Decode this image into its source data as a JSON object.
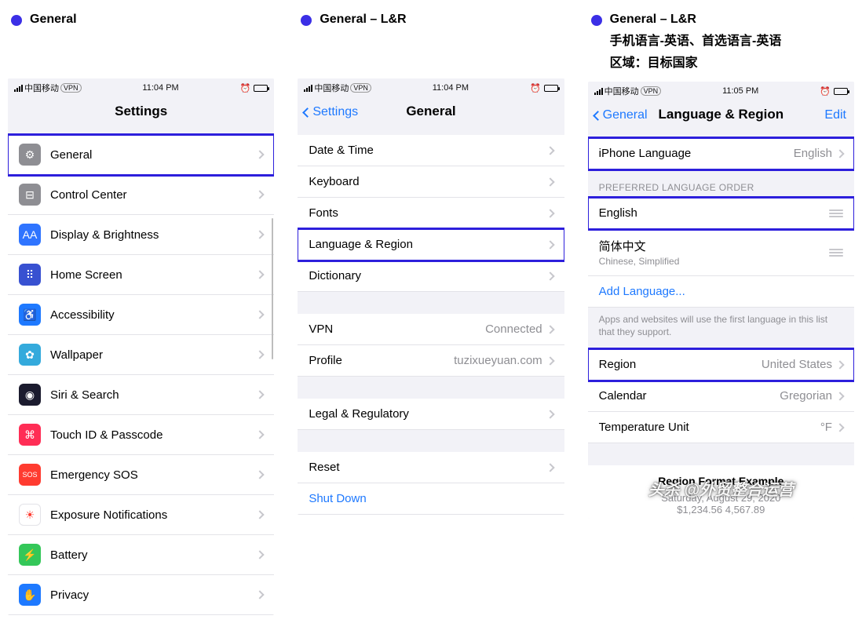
{
  "columns": [
    {
      "title": "General"
    },
    {
      "title": "General – L&R"
    },
    {
      "title": "General – L&R",
      "sub1": "手机语言-英语、首选语言-英语",
      "sub2": "区域：目标国家"
    }
  ],
  "phone1": {
    "status": {
      "carrier": "中国移动",
      "time": "11:04 PM"
    },
    "nav_title": "Settings",
    "rows": [
      {
        "icon": "gear-icon",
        "bg": "#8e8e93",
        "glyph": "⚙",
        "label": "General",
        "highlight": true
      },
      {
        "icon": "control-center-icon",
        "bg": "#8e8e93",
        "glyph": "⊟",
        "label": "Control Center"
      },
      {
        "icon": "display-icon",
        "bg": "#2f74ff",
        "glyph": "AA",
        "label": "Display & Brightness"
      },
      {
        "icon": "home-screen-icon",
        "bg": "#3851d1",
        "glyph": "⠿",
        "label": "Home Screen"
      },
      {
        "icon": "accessibility-icon",
        "bg": "#1e79ff",
        "glyph": "♿",
        "label": "Accessibility"
      },
      {
        "icon": "wallpaper-icon",
        "bg": "#34aadc",
        "glyph": "✿",
        "label": "Wallpaper"
      },
      {
        "icon": "siri-icon",
        "bg": "#1b1b2e",
        "glyph": "◉",
        "label": "Siri & Search"
      },
      {
        "icon": "touchid-icon",
        "bg": "#ff2d55",
        "glyph": "⌘",
        "label": "Touch ID & Passcode"
      },
      {
        "icon": "sos-icon",
        "bg": "#ff3b30",
        "glyph": "SOS",
        "label": "Emergency SOS"
      },
      {
        "icon": "exposure-icon",
        "bg": "#fff",
        "fg": "#ff3b30",
        "glyph": "☀",
        "label": "Exposure Notifications",
        "border": true
      },
      {
        "icon": "battery-icon",
        "bg": "#34c759",
        "glyph": "⚡",
        "label": "Battery"
      },
      {
        "icon": "privacy-icon",
        "bg": "#1e79ff",
        "glyph": "✋",
        "label": "Privacy"
      }
    ]
  },
  "phone2": {
    "status": {
      "carrier": "中国移动",
      "time": "11:04 PM"
    },
    "nav_back": "Settings",
    "nav_title": "General",
    "groups": [
      [
        {
          "label": "Date & Time"
        },
        {
          "label": "Keyboard"
        },
        {
          "label": "Fonts"
        },
        {
          "label": "Language & Region",
          "highlight": true
        },
        {
          "label": "Dictionary"
        }
      ],
      [
        {
          "label": "VPN",
          "value": "Connected"
        },
        {
          "label": "Profile",
          "value": "tuzixueyuan.com"
        }
      ],
      [
        {
          "label": "Legal & Regulatory"
        }
      ],
      [
        {
          "label": "Reset"
        },
        {
          "label": "Shut Down",
          "link": true,
          "nochev": true
        }
      ]
    ]
  },
  "phone3": {
    "status": {
      "carrier": "中国移动",
      "time": "11:05 PM"
    },
    "nav_back": "General",
    "nav_title": "Language & Region",
    "nav_right": "Edit",
    "iphone_lang": {
      "label": "iPhone Language",
      "value": "English"
    },
    "pref_header": "PREFERRED LANGUAGE ORDER",
    "pref_items": [
      {
        "label": "English",
        "highlight": true
      },
      {
        "label": "简体中文",
        "sub": "Chinese, Simplified"
      }
    ],
    "add_lang": "Add Language...",
    "pref_footer": "Apps and websites will use the first language in this list that they support.",
    "region_items": [
      {
        "label": "Region",
        "value": "United States",
        "highlight": true
      },
      {
        "label": "Calendar",
        "value": "Gregorian"
      },
      {
        "label": "Temperature Unit",
        "value": "°F"
      }
    ],
    "example": {
      "title": "Region Format Example",
      "line1": "Saturday, August 29, 2020",
      "line2": "$1,234.56   4,567.89"
    }
  },
  "watermark": "头杀 @外贸整合运营"
}
